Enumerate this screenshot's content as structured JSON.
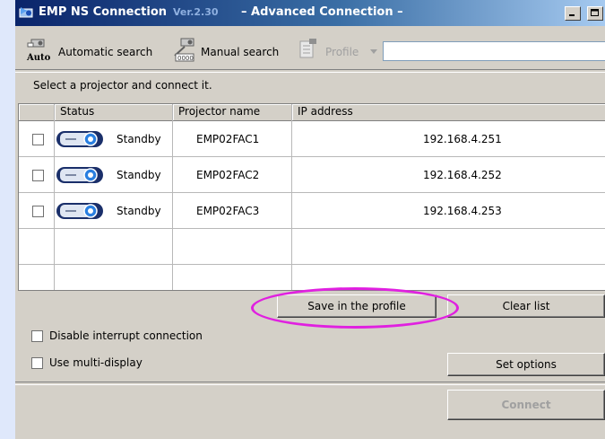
{
  "window": {
    "title": "EMP NS Connection",
    "version": "Ver.2.30",
    "subtitle": "– Advanced Connection –"
  },
  "toolbar": {
    "automatic_search_label": "Automatic search",
    "auto_icon_text": "Auto",
    "manual_search_label": "Manual search",
    "profile_label": "Profile",
    "profile_value": ""
  },
  "instruction": "Select a projector and connect it.",
  "table": {
    "columns": [
      "Status",
      "Projector name",
      "IP address"
    ],
    "rows": [
      {
        "checked": false,
        "status": "Standby",
        "name": "EMP02FAC1",
        "ip": "192.168.4.251"
      },
      {
        "checked": false,
        "status": "Standby",
        "name": "EMP02FAC2",
        "ip": "192.168.4.252"
      },
      {
        "checked": false,
        "status": "Standby",
        "name": "EMP02FAC3",
        "ip": "192.168.4.253"
      }
    ]
  },
  "buttons": {
    "save_profile": "Save in the profile",
    "clear_list": "Clear list",
    "set_options": "Set options",
    "connect": "Connect"
  },
  "options": {
    "disable_interrupt": {
      "label": "Disable interrupt connection",
      "checked": false
    },
    "multi_display": {
      "label": "Use multi-display",
      "checked": false
    }
  },
  "colors": {
    "title_bar": "#0a246a",
    "highlight": "#e020e0",
    "background": "#dfe8fb"
  }
}
